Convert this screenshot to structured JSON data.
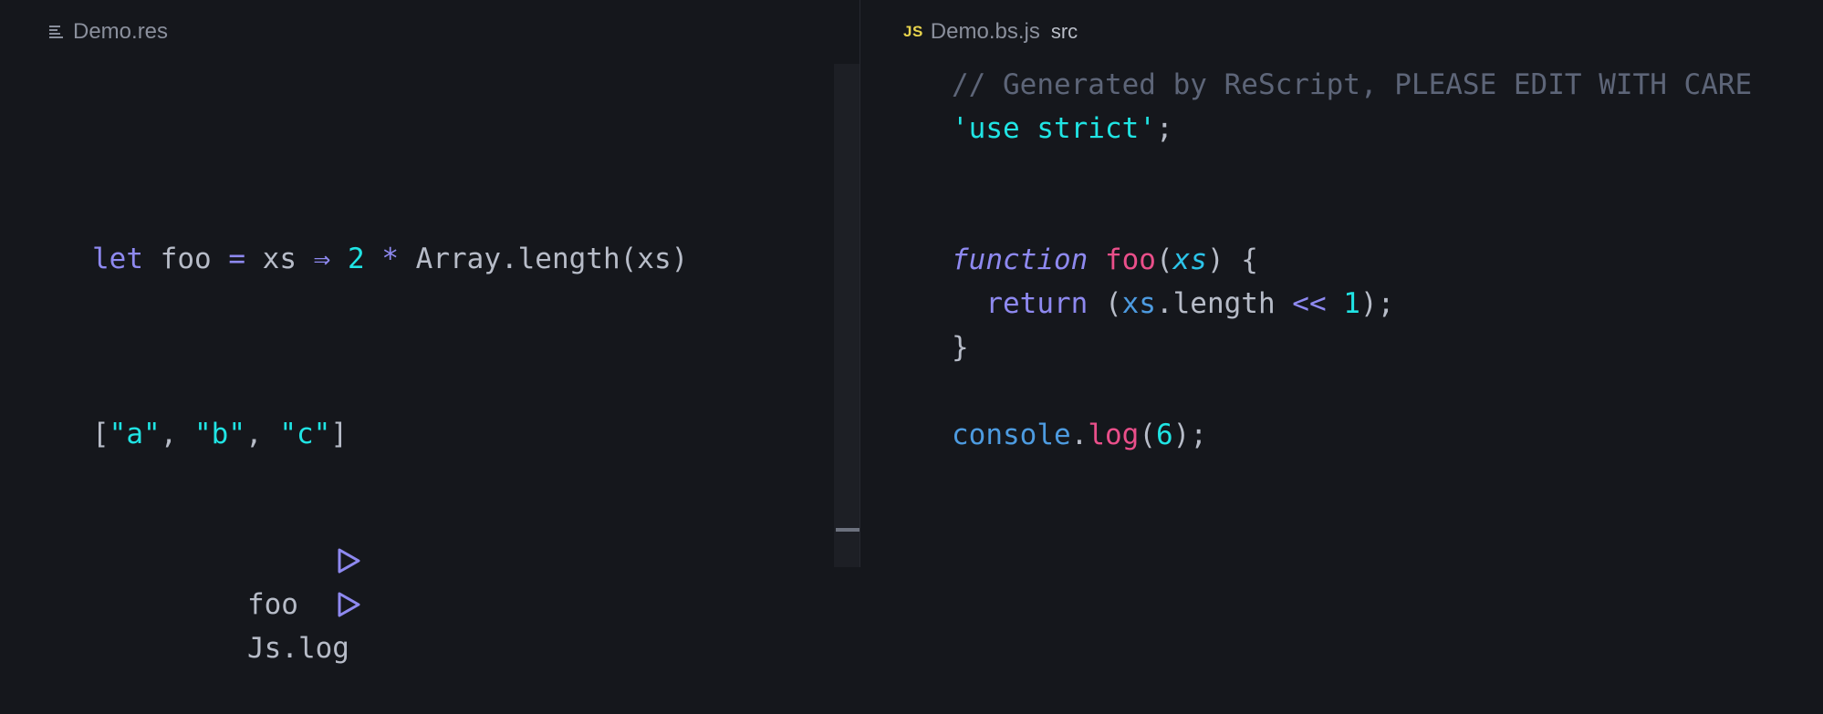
{
  "left_tab": {
    "icon": "document-lines-icon",
    "filename": "Demo.res"
  },
  "right_tab": {
    "icon": "js-file-icon",
    "icon_text": "JS",
    "filename": "Demo.bs.js",
    "directory": "src"
  },
  "left_code": {
    "line1": {
      "let": "let",
      "name": " foo ",
      "eq": "=",
      "arg": " xs ",
      "arrow": "⇒",
      "num": " 2 ",
      "star": "*",
      "rest": " Array.length(xs)"
    },
    "array": {
      "open": "[",
      "a": "\"a\"",
      "c1": ", ",
      "b": "\"b\"",
      "c2": ", ",
      "c": "\"c\"",
      "close": "]"
    },
    "outputs": [
      {
        "icon": "play-triangle-icon",
        "label": "foo"
      },
      {
        "icon": "play-triangle-icon",
        "label": "Js.log"
      }
    ]
  },
  "right_code": {
    "comment": "// Generated by ReScript, PLEASE EDIT WITH CARE",
    "strict": {
      "str": "'use strict'",
      "semi": ";"
    },
    "func": {
      "kw": "function",
      "name": "foo",
      "open": "(",
      "arg": "xs",
      "close": ") {"
    },
    "ret": {
      "kw": "return",
      "open": " (",
      "id": "xs",
      "prop": ".length ",
      "op": "<<",
      "num": " 1",
      "close": ");"
    },
    "brace": "}",
    "log": {
      "obj": "console",
      "dot": ".",
      "fn": "log",
      "open": "(",
      "num": "6",
      "close": ");"
    }
  },
  "colors": {
    "background": "#15171c",
    "keyword": "#8e89f0",
    "number": "#20e4e4",
    "function": "#ea4f8a",
    "comment": "#5d6578",
    "js_badge": "#e8d44d"
  }
}
